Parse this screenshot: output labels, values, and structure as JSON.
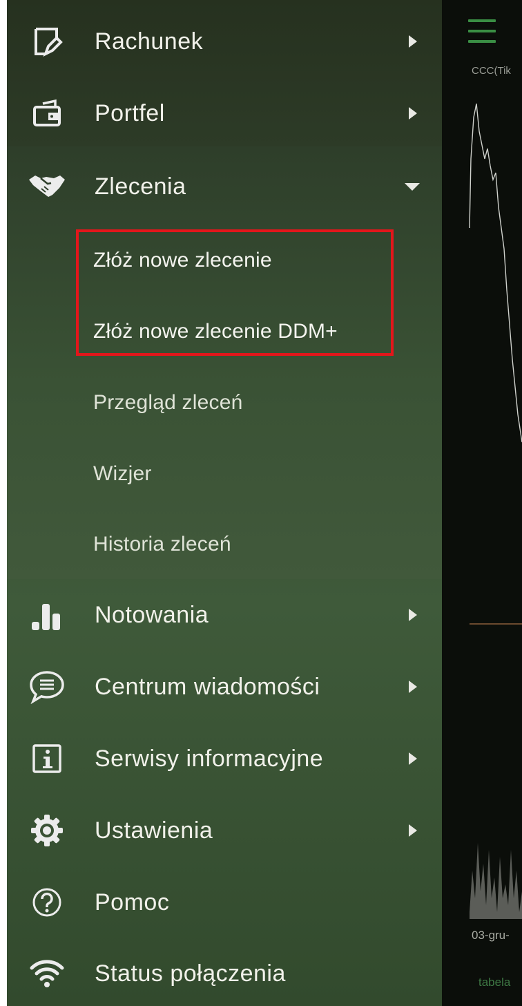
{
  "menu": {
    "items": [
      {
        "label": "Rachunek",
        "icon": "document-pen-icon",
        "arrow": "right"
      },
      {
        "label": "Portfel",
        "icon": "wallet-icon",
        "arrow": "right"
      },
      {
        "label": "Zlecenia",
        "icon": "handshake-icon",
        "arrow": "down"
      },
      {
        "label": "Notowania",
        "icon": "bar-chart-icon",
        "arrow": "right"
      },
      {
        "label": "Centrum wiadomości",
        "icon": "chat-bubble-icon",
        "arrow": "right"
      },
      {
        "label": "Serwisy informacyjne",
        "icon": "info-icon",
        "arrow": "right"
      },
      {
        "label": "Ustawienia",
        "icon": "gear-icon",
        "arrow": "right"
      },
      {
        "label": "Pomoc",
        "icon": "help-icon",
        "arrow": "none"
      },
      {
        "label": "Status połączenia",
        "icon": "wifi-icon",
        "arrow": "none"
      }
    ],
    "zlecenia_sub": [
      {
        "label": "Złóż nowe zlecenie",
        "highlighted": true
      },
      {
        "label": "Złóż nowe zlecenie DDM+",
        "highlighted": true
      },
      {
        "label": "Przegląd zleceń",
        "highlighted": false
      },
      {
        "label": "Wizjer",
        "highlighted": false
      },
      {
        "label": "Historia zleceń",
        "highlighted": false
      }
    ]
  },
  "background": {
    "ticker": "CCC(Tik",
    "date_label": "03-gru-",
    "tab_label": "tabela"
  },
  "colors": {
    "highlight": "#e3161b",
    "accent": "#3a8e44",
    "drawer_text": "#f1f1ea"
  }
}
